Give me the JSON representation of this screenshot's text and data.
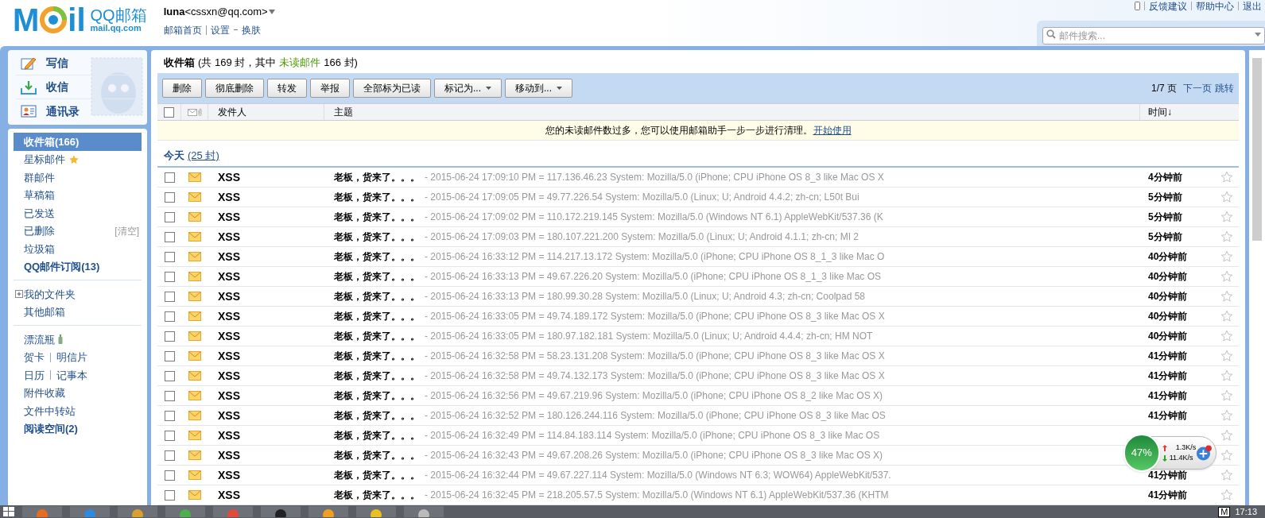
{
  "header": {
    "logo": {
      "left": "M",
      "right": "il",
      "name": "QQ邮箱",
      "domain": "mail.qq.com"
    },
    "user": {
      "name": "luna",
      "email": "<cssxn@qq.com>"
    },
    "links": [
      "邮箱首页",
      "设置",
      "换肤"
    ],
    "top_links": [
      "反馈建议",
      "帮助中心",
      "退出"
    ],
    "search": {
      "placeholder": "邮件搜索..."
    }
  },
  "sidebar": {
    "actions": [
      {
        "kind": "compose",
        "label": "写信"
      },
      {
        "kind": "inbox",
        "label": "收信"
      },
      {
        "kind": "contacts",
        "label": "通讯录"
      }
    ],
    "groups": [
      [
        {
          "kind": "plain",
          "label": "收件箱(166)",
          "selected": true,
          "bold": true
        },
        {
          "kind": "starred",
          "label": "星标邮件",
          "selected": false,
          "bold": false
        },
        {
          "kind": "plain",
          "label": "群邮件",
          "selected": false,
          "bold": false
        },
        {
          "kind": "plain",
          "label": "草稿箱",
          "selected": false,
          "bold": false
        },
        {
          "kind": "plain",
          "label": "已发送",
          "selected": false,
          "bold": false
        },
        {
          "kind": "clearable",
          "label": "已删除",
          "action": "[清空]",
          "selected": false,
          "bold": false
        },
        {
          "kind": "plain",
          "label": "垃圾箱",
          "selected": false,
          "bold": false
        },
        {
          "kind": "plain",
          "label": "QQ邮件订阅(13)",
          "selected": false,
          "bold": true
        }
      ],
      [
        {
          "kind": "expandable",
          "label": "我的文件夹",
          "selected": false,
          "bold": false
        },
        {
          "kind": "plain",
          "label": "其他邮箱",
          "selected": false,
          "bold": false
        }
      ],
      [
        {
          "kind": "bottle",
          "label": "漂流瓶",
          "selected": false,
          "bold": false
        },
        {
          "kind": "pair",
          "labels": [
            "贺卡",
            "明信片"
          ],
          "selected": false,
          "bold": false
        },
        {
          "kind": "pair",
          "labels": [
            "日历",
            "记事本"
          ],
          "selected": false,
          "bold": false
        },
        {
          "kind": "plain",
          "label": "附件收藏",
          "selected": false,
          "bold": false
        },
        {
          "kind": "plain",
          "label": "文件中转站",
          "selected": false,
          "bold": false
        },
        {
          "kind": "plain",
          "label": "阅读空间(2)",
          "selected": false,
          "bold": true
        }
      ]
    ]
  },
  "main": {
    "title": "收件箱",
    "summary_before": "(共 169 封，其中",
    "unread_link": "未读邮件",
    "summary_after": "166 封)",
    "toolbar": [
      {
        "label": "删除",
        "dropdown": false
      },
      {
        "label": "彻底删除",
        "dropdown": false
      },
      {
        "label": "转发",
        "dropdown": false
      },
      {
        "label": "举报",
        "dropdown": false
      },
      {
        "label": "全部标为已读",
        "dropdown": false
      },
      {
        "label": "标记为...",
        "dropdown": true
      },
      {
        "label": "移动到...",
        "dropdown": true
      }
    ],
    "pager": {
      "page": "1/7 页",
      "next": "下一页",
      "jump": "跳转"
    },
    "columns": {
      "select_all_checked": false,
      "sender": "发件人",
      "subject": "主题",
      "time": "时间↓"
    },
    "notice": {
      "text": "您的未读邮件数过多，您可以使用邮箱助手一步一步进行清理。",
      "link": "开始使用"
    },
    "group": {
      "label": "今天",
      "count": "(25 封)"
    },
    "rows": [
      {
        "sender": "XSS",
        "subject": "老板，货来了。。。",
        "preview": "- 2015-06-24 17:09:10 PM = 117.136.46.23 System: Mozilla/5.0 (iPhone; CPU iPhone OS 8_3 like Mac OS X",
        "time": "4分钟前",
        "unread": true,
        "checked": false,
        "starred": false
      },
      {
        "sender": "XSS",
        "subject": "老板，货来了。。。",
        "preview": "- 2015-06-24 17:09:05 PM = 49.77.226.54 System: Mozilla/5.0 (Linux; U; Android 4.4.2; zh-cn; L50t Bui",
        "time": "5分钟前",
        "unread": true,
        "checked": false,
        "starred": false
      },
      {
        "sender": "XSS",
        "subject": "老板，货来了。。。",
        "preview": "- 2015-06-24 17:09:02 PM = 110.172.219.145 System: Mozilla/5.0 (Windows NT 6.1) AppleWebKit/537.36 (K",
        "time": "5分钟前",
        "unread": true,
        "checked": false,
        "starred": false
      },
      {
        "sender": "XSS",
        "subject": "老板，货来了。。。",
        "preview": "- 2015-06-24 17:09:03 PM = 180.107.221.200 System: Mozilla/5.0 (Linux; U; Android 4.1.1; zh-cn; MI 2",
        "time": "5分钟前",
        "unread": true,
        "checked": false,
        "starred": false
      },
      {
        "sender": "XSS",
        "subject": "老板，货来了。。。",
        "preview": "- 2015-06-24 16:33:12 PM = 114.217.13.172 System: Mozilla/5.0 (iPhone; CPU iPhone OS 8_1_3 like Mac O",
        "time": "40分钟前",
        "unread": true,
        "checked": false,
        "starred": false
      },
      {
        "sender": "XSS",
        "subject": "老板，货来了。。。",
        "preview": "- 2015-06-24 16:33:13 PM = 49.67.226.20 System: Mozilla/5.0 (iPhone; CPU iPhone OS 8_1_3 like Mac OS",
        "time": "40分钟前",
        "unread": true,
        "checked": false,
        "starred": false
      },
      {
        "sender": "XSS",
        "subject": "老板，货来了。。。",
        "preview": "- 2015-06-24 16:33:13 PM = 180.99.30.28 System: Mozilla/5.0 (Linux; U; Android 4.3; zh-cn; Coolpad 58",
        "time": "40分钟前",
        "unread": true,
        "checked": false,
        "starred": false
      },
      {
        "sender": "XSS",
        "subject": "老板，货来了。。。",
        "preview": "- 2015-06-24 16:33:05 PM = 49.74.189.172 System: Mozilla/5.0 (iPhone; CPU iPhone OS 8_3 like Mac OS X",
        "time": "40分钟前",
        "unread": true,
        "checked": false,
        "starred": false
      },
      {
        "sender": "XSS",
        "subject": "老板，货来了。。。",
        "preview": "- 2015-06-24 16:33:05 PM = 180.97.182.181 System: Mozilla/5.0 (Linux; U; Android 4.4.4; zh-cn; HM NOT",
        "time": "40分钟前",
        "unread": true,
        "checked": false,
        "starred": false
      },
      {
        "sender": "XSS",
        "subject": "老板，货来了。。。",
        "preview": "- 2015-06-24 16:32:58 PM = 58.23.131.208 System: Mozilla/5.0 (iPhone; CPU iPhone OS 8_3 like Mac OS X",
        "time": "41分钟前",
        "unread": true,
        "checked": false,
        "starred": false
      },
      {
        "sender": "XSS",
        "subject": "老板，货来了。。。",
        "preview": "- 2015-06-24 16:32:58 PM = 49.74.132.173 System: Mozilla/5.0 (iPhone; CPU iPhone OS 8_3 like Mac OS X",
        "time": "41分钟前",
        "unread": true,
        "checked": false,
        "starred": false
      },
      {
        "sender": "XSS",
        "subject": "老板，货来了。。。",
        "preview": "- 2015-06-24 16:32:56 PM = 49.67.219.96 System: Mozilla/5.0 (iPhone; CPU iPhone OS 8_2 like Mac OS X)",
        "time": "41分钟前",
        "unread": true,
        "checked": false,
        "starred": false
      },
      {
        "sender": "XSS",
        "subject": "老板，货来了。。。",
        "preview": "- 2015-06-24 16:32:52 PM = 180.126.244.116 System: Mozilla/5.0 (iPhone; CPU iPhone OS 8_3 like Mac OS",
        "time": "41分钟前",
        "unread": true,
        "checked": false,
        "starred": false
      },
      {
        "sender": "XSS",
        "subject": "老板，货来了。。。",
        "preview": "- 2015-06-24 16:32:49 PM = 114.84.183.114 System: Mozilla/5.0 (iPhone; CPU iPhone OS 8_3 like Mac OS",
        "unread": true,
        "checked": false,
        "starred": false
      },
      {
        "sender": "XSS",
        "subject": "老板，货来了。。。",
        "preview": "- 2015-06-24 16:32:43 PM = 49.67.208.26 System: Mozilla/5.0 (iPhone; CPU iPhone OS 8_3 like Mac OS X)",
        "unread": true,
        "checked": false,
        "starred": false
      },
      {
        "sender": "XSS",
        "subject": "老板，货来了。。。",
        "preview": "- 2015-06-24 16:32:44 PM = 49.67.227.114 System: Mozilla/5.0 (Windows NT 6.3; WOW64) AppleWebKit/537.",
        "time": "41分钟前",
        "unread": true,
        "checked": false,
        "starred": false
      },
      {
        "sender": "XSS",
        "subject": "老板，货来了。。。",
        "preview": "- 2015-06-24 16:32:45 PM = 218.205.57.5 System: Mozilla/5.0 (Windows NT 6.1) AppleWebKit/537.36 (KHTM",
        "time": "41分钟前",
        "unread": true,
        "checked": false,
        "starred": false
      }
    ]
  },
  "widget": {
    "percent": "47%",
    "upload": "1.3K/s",
    "download": "11.4K/s"
  },
  "taskbar": {
    "tray_label": "M",
    "clock": "17:13"
  }
}
